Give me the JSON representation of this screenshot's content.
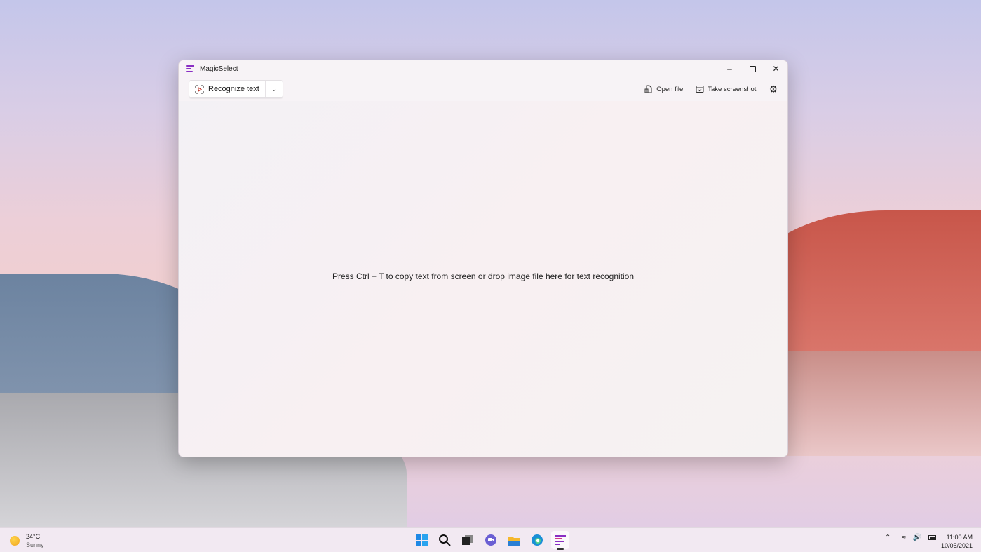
{
  "window": {
    "title": "MagicSelect",
    "minimize_icon": "minimize-icon",
    "maximize_icon": "maximize-icon",
    "close_icon": "close-icon"
  },
  "toolbar": {
    "recognize_label": "Recognize text",
    "open_file_label": "Open file",
    "take_screenshot_label": "Take screenshot"
  },
  "content": {
    "hint": "Press Ctrl + T to copy text from screen or drop image file here for text recognition"
  },
  "taskbar": {
    "weather": {
      "temp": "24°C",
      "condition": "Sunny"
    },
    "apps": [
      "start",
      "search",
      "task-view",
      "chat",
      "file-explorer",
      "edge",
      "magicselect"
    ],
    "clock": {
      "time": "11:00 AM",
      "date": "10/05/2021"
    }
  },
  "colors": {
    "accent": "#8a2fc4"
  }
}
